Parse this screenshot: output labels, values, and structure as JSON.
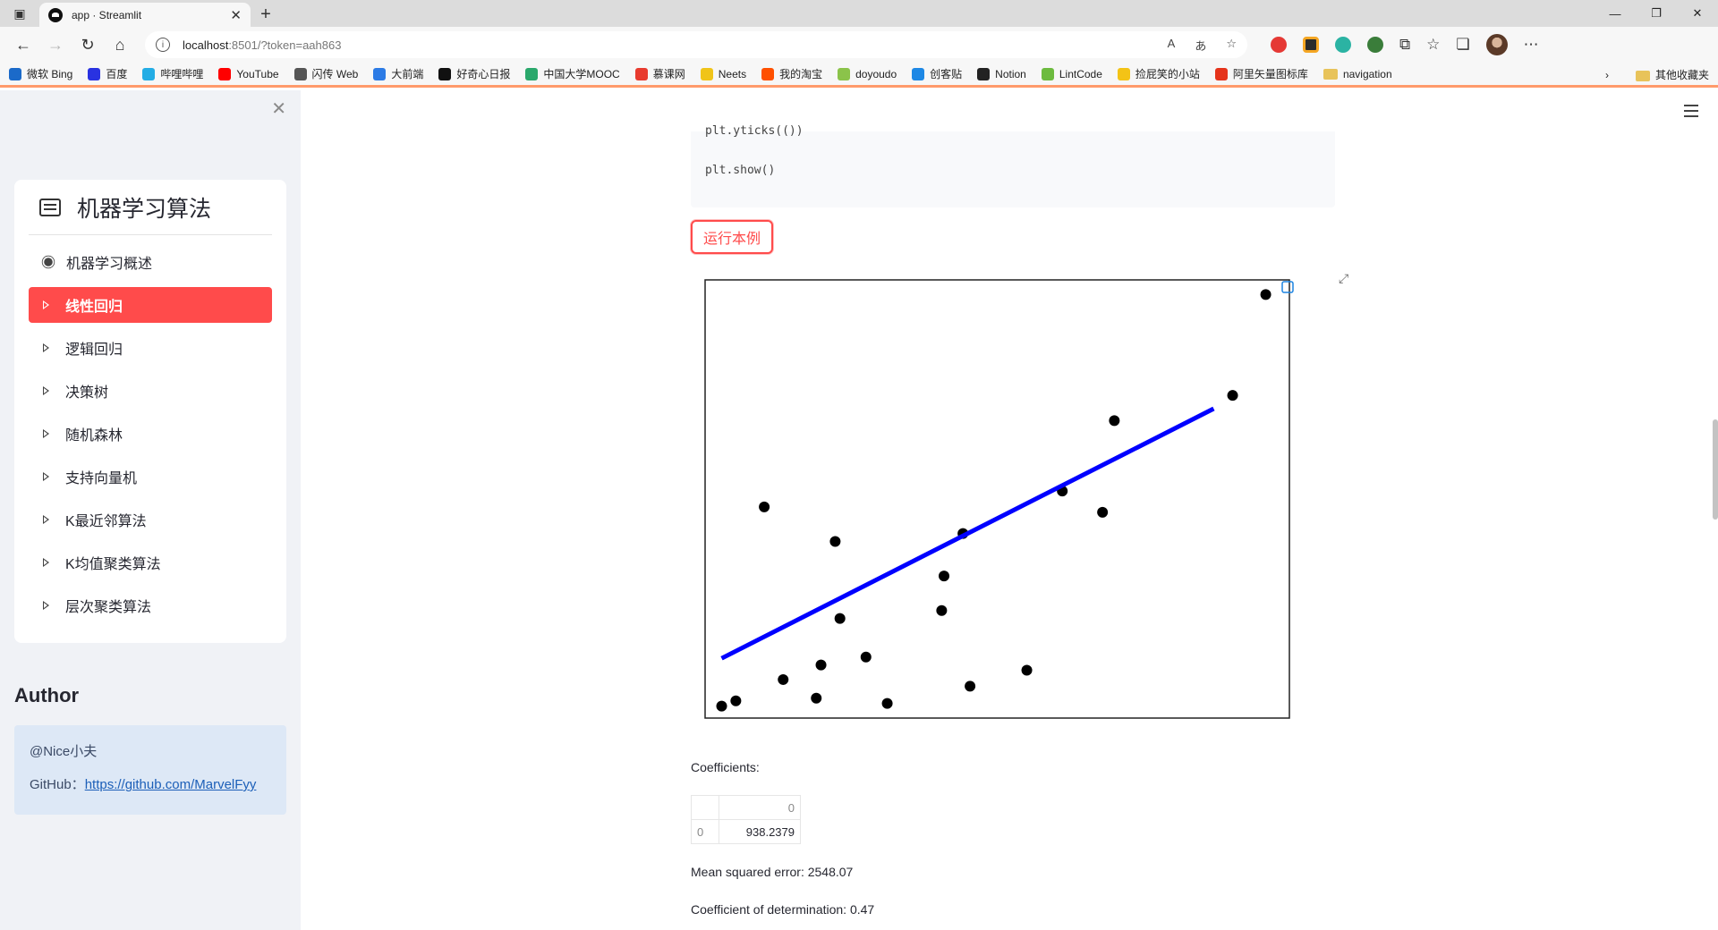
{
  "browser": {
    "tab_title": "app · Streamlit",
    "url_host": "localhost",
    "url_rest": ":8501/?token=aah863",
    "bookmarks": [
      {
        "label": "微软 Bing",
        "color": "#1b6ac9"
      },
      {
        "label": "百度",
        "color": "#2932e1"
      },
      {
        "label": "哔哩哔哩",
        "color": "#23ade5"
      },
      {
        "label": "YouTube",
        "color": "#ff0000"
      },
      {
        "label": "闪传 Web",
        "color": "#555555"
      },
      {
        "label": "大前端",
        "color": "#2c7be5"
      },
      {
        "label": "好奇心日报",
        "color": "#111111"
      },
      {
        "label": "中国大学MOOC",
        "color": "#2aa86c"
      },
      {
        "label": "慕课网",
        "color": "#e83b2e"
      },
      {
        "label": "Neets",
        "color": "#f0c419"
      },
      {
        "label": "我的淘宝",
        "color": "#ff5000"
      },
      {
        "label": "doyoudo",
        "color": "#8bc34a"
      },
      {
        "label": "创客贴",
        "color": "#1e88e5"
      },
      {
        "label": "Notion",
        "color": "#222222"
      },
      {
        "label": "LintCode",
        "color": "#6dbb3f"
      },
      {
        "label": "捡屁笑的小站",
        "color": "#f3c316"
      },
      {
        "label": "阿里矢量图标库",
        "color": "#e5331b"
      },
      {
        "label": "navigation",
        "color": "#e8c35a"
      }
    ],
    "other_bookmarks": "其他收藏夹"
  },
  "sidebar": {
    "menu_title": "机器学习算法",
    "items": [
      {
        "label": "机器学习概述",
        "icon": "sun-icon"
      },
      {
        "label": "线性回归",
        "icon": "caret-right-icon"
      },
      {
        "label": "逻辑回归",
        "icon": "caret-right-icon"
      },
      {
        "label": "决策树",
        "icon": "caret-right-icon"
      },
      {
        "label": "随机森林",
        "icon": "caret-right-icon"
      },
      {
        "label": "支持向量机",
        "icon": "caret-right-icon"
      },
      {
        "label": "K最近邻算法",
        "icon": "caret-right-icon"
      },
      {
        "label": "K均值聚类算法",
        "icon": "caret-right-icon"
      },
      {
        "label": "层次聚类算法",
        "icon": "caret-right-icon"
      }
    ],
    "active_index": 1,
    "author_heading": "Author",
    "author_name": "@Nice小夫",
    "github_label": "GitHub：",
    "github_url": "https://github.com/MarvelFyy"
  },
  "main": {
    "code_line_1": "plt.yticks(())",
    "code_line_2": "plt.show()",
    "run_button": "运行本例",
    "coefficients_label": "Coefficients:",
    "table": {
      "header": [
        "",
        "0"
      ],
      "rows": [
        [
          "0",
          "938.2379"
        ]
      ]
    },
    "mse_text": "Mean squared error: 2548.07",
    "r2_text": "Coefficient of determination: 0.47"
  },
  "colors": {
    "accent": "#ff4b4b",
    "line": "#0000ff",
    "points": "#000000"
  },
  "chart_data": {
    "type": "scatter",
    "x": [
      0.077,
      0.083,
      0.103,
      0.095,
      0.117,
      0.119,
      0.125,
      0.127,
      0.147,
      0.138,
      0.171,
      0.17,
      0.179,
      0.182,
      0.206,
      0.221,
      0.243,
      0.238,
      0.293,
      0.307
    ],
    "y": [
      24,
      28,
      44,
      174,
      30,
      55,
      148,
      90,
      26,
      61,
      122,
      96,
      154,
      39,
      51,
      186,
      239,
      170,
      258,
      334
    ],
    "fit_line": {
      "x": [
        0.077,
        0.285
      ],
      "y": [
        60,
        248
      ]
    },
    "xlim": [
      0.07,
      0.317
    ],
    "ylim": [
      15,
      345
    ],
    "grid": false,
    "ticks": false
  }
}
